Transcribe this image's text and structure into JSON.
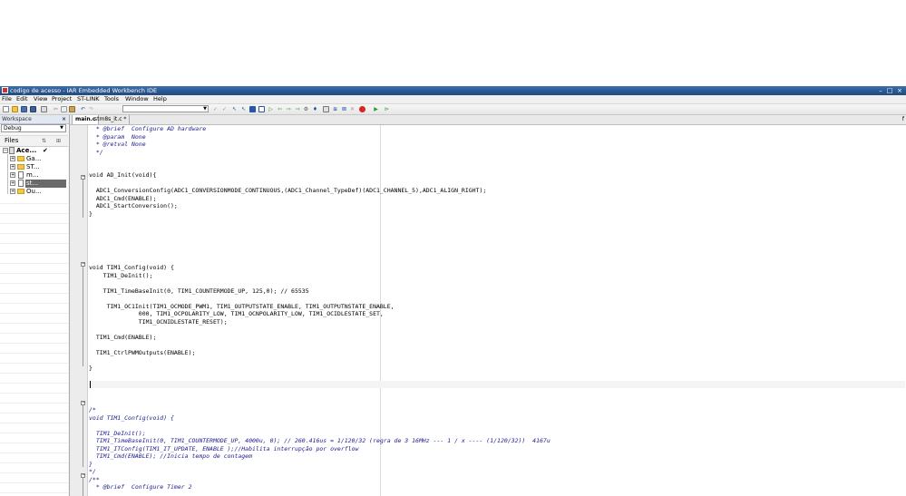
{
  "window": {
    "title": "codigo de acesso - IAR Embedded Workbench IDE",
    "controls": [
      "–",
      "□",
      "×"
    ]
  },
  "menu": [
    "File",
    "Edit",
    "View",
    "Project",
    "ST-LINK",
    "Tools",
    "Window",
    "Help"
  ],
  "workspace": {
    "title": "Workspace",
    "close": "×",
    "config": "Debug",
    "files_header": "Files",
    "tree": [
      {
        "name": "Ace...",
        "check": "✔"
      },
      {
        "name": "Ga..."
      },
      {
        "name": "ST..."
      },
      {
        "name": "m..."
      },
      {
        "name": "st..."
      },
      {
        "name": "Ou..."
      }
    ]
  },
  "editor": {
    "tabs": [
      "main.c",
      "stm8s_it.c *"
    ],
    "tab_end": "f",
    "lines": [
      "  * @brief  Configure AD hardware",
      "  * @param  None",
      "  * @retval None",
      "  */",
      "",
      "",
      "void AD_Init(void){",
      "",
      "  ADC1_ConversionConfig(ADC1_CONVERSIONMODE_CONTINUOUS,(ADC1_Channel_TypeDef)(ADC1_CHANNEL_5),ADC1_ALIGN_RIGHT);",
      "  ADC1_Cmd(ENABLE);",
      "  ADC1_StartConversion();",
      "}",
      "",
      "",
      "",
      "",
      "",
      "",
      "void TIM1_Config(void) {",
      "    TIM1_DeInit();",
      "",
      "    TIM1_TimeBaseInit(0, TIM1_COUNTERMODE_UP, 125,0); // 65535",
      "",
      "     TIM1_OC1Init(TIM1_OCMODE_PWM1, TIM1_OUTPUTSTATE_ENABLE, TIM1_OUTPUTNSTATE_ENABLE,",
      "              000, TIM1_OCPOLARITY_LOW, TIM1_OCNPOLARITY_LOW, TIM1_OCIDLESTATE_SET,",
      "              TIM1_OCNIDLESTATE_RESET);",
      "",
      "  TIM1_Cmd(ENABLE);",
      "",
      "  TIM1_CtrlPWMOutputs(ENABLE);",
      "",
      "}",
      "",
      "",
      "",
      "",
      "",
      "/*",
      "void TIM1_Config(void) {",
      "",
      "  TIM1_DeInit();",
      "  TIM1_TimeBaseInit(0, TIM1_COUNTERMODE_UP, 4000u, 0); // 260.416us = 1/120/32 (regra de 3 16MHz --- 1 / x ---- (1/120/32))  4167u",
      "  TIM1_ITConfig(TIM1_IT_UPDATE, ENABLE );//Habilita interrupção por overflow",
      "  TIM1_Cmd(ENABLE); //Inicia tempo de contagem",
      "}",
      "*/",
      "/**",
      "  * @brief  Configure Timer 2"
    ]
  },
  "colors": {
    "titlebar": "#2a568f",
    "comment": "#1a1a8c",
    "number": "#8a2be2"
  }
}
